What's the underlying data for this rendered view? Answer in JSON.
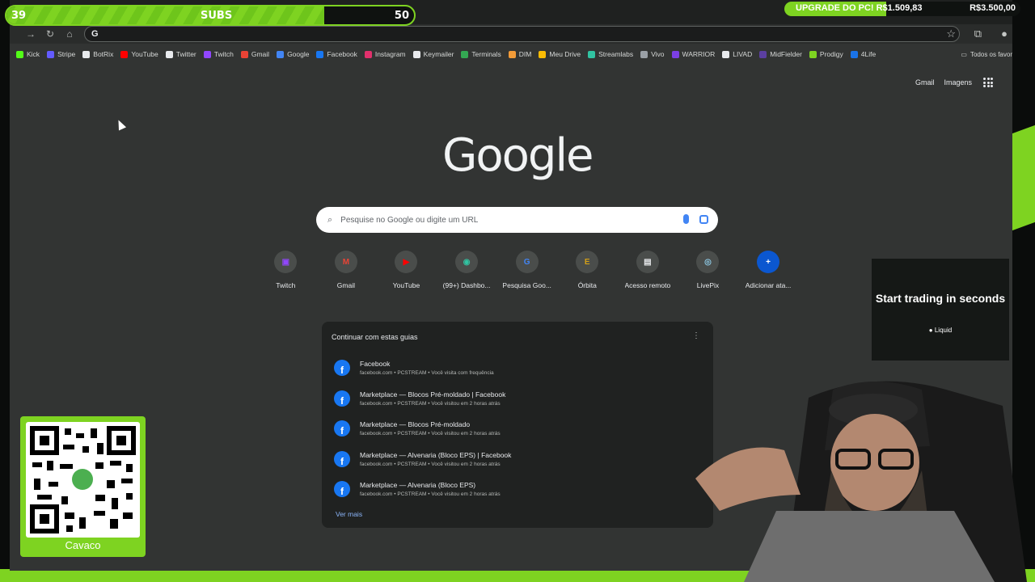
{
  "overlay": {
    "subs_current": "39",
    "subs_label": "SUBS",
    "subs_goal": "50",
    "subs_progress_fraction": 0.78,
    "upgrade_text": "UPGRADE DO PC! R$1.509,83",
    "upgrade_goal": "R$3.500,00",
    "upgrade_progress_fraction": 0.43,
    "qr_label": "Cavaco",
    "ad_title": "Start trading in seconds",
    "ad_brand": "Liquid"
  },
  "browser": {
    "omnibox_value": "G",
    "bookmarks": [
      {
        "label": "Kick",
        "color": "#53fc18"
      },
      {
        "label": "Stripe",
        "color": "#635bff"
      },
      {
        "label": "BotRix",
        "color": "#e8eaed"
      },
      {
        "label": "YouTube",
        "color": "#ff0000"
      },
      {
        "label": "Twitter",
        "color": "#e8eaed"
      },
      {
        "label": "Twitch",
        "color": "#9146ff"
      },
      {
        "label": "Gmail",
        "color": "#ea4335"
      },
      {
        "label": "Google",
        "color": "#4285f4"
      },
      {
        "label": "Facebook",
        "color": "#1877f2"
      },
      {
        "label": "Instagram",
        "color": "#e1306c"
      },
      {
        "label": "Keymailer",
        "color": "#e8eaed"
      },
      {
        "label": "Terminals",
        "color": "#34a853"
      },
      {
        "label": "DIM",
        "color": "#f29b38"
      },
      {
        "label": "Meu Drive",
        "color": "#fbbc04"
      },
      {
        "label": "Streamlabs",
        "color": "#31c3a2"
      },
      {
        "label": "Vivo",
        "color": "#9aa0a6"
      },
      {
        "label": "WARRIOR",
        "color": "#7b3fe4"
      },
      {
        "label": "LIVAD",
        "color": "#e8eaed"
      },
      {
        "label": "MidFielder",
        "color": "#5b3fa0"
      },
      {
        "label": "Prodigy",
        "color": "#7ed321"
      },
      {
        "label": "4Life",
        "color": "#1a73e8"
      }
    ],
    "bookmarks_all": "Todos os favor"
  },
  "google": {
    "top_links": [
      "Gmail",
      "Imagens"
    ],
    "logo": "Google",
    "search_placeholder": "Pesquise no Google ou digite um URL",
    "shortcuts": [
      {
        "label": "Twitch",
        "glyph": "▣",
        "color": "#9146ff"
      },
      {
        "label": "Gmail",
        "glyph": "M",
        "color": "#ea4335"
      },
      {
        "label": "YouTube",
        "glyph": "▶",
        "color": "#ff0000"
      },
      {
        "label": "(99+) Dashbo...",
        "glyph": "◉",
        "color": "#31c3a2"
      },
      {
        "label": "Pesquisa Goo...",
        "glyph": "G",
        "color": "#4285f4"
      },
      {
        "label": "Órbita",
        "glyph": "E",
        "color": "#d4a017"
      },
      {
        "label": "Acesso remoto",
        "glyph": "▤",
        "color": "#e8eaed"
      },
      {
        "label": "LivePix",
        "glyph": "◎",
        "color": "#8ecae6"
      },
      {
        "label": "Adicionar ata...",
        "glyph": "+",
        "color": "#8ab4f8"
      }
    ],
    "continue_title": "Continuar com estas guias",
    "tabs": [
      {
        "title": "Facebook",
        "subtitle": "facebook.com • PCSTREAM • Você visita com frequência"
      },
      {
        "title": "Marketplace — Blocos Pré-moldado | Facebook",
        "subtitle": "facebook.com • PCSTREAM • Você visitou em 2 horas atrás"
      },
      {
        "title": "Marketplace — Blocos Pré-moldado",
        "subtitle": "facebook.com • PCSTREAM • Você visitou em 2 horas atrás"
      },
      {
        "title": "Marketplace — Alvenaria (Bloco EPS) | Facebook",
        "subtitle": "facebook.com • PCSTREAM • Você visitou em 2 horas atrás"
      },
      {
        "title": "Marketplace — Alvenaria (Bloco EPS)",
        "subtitle": "facebook.com • PCSTREAM • Você visitou em 2 horas atrás"
      }
    ],
    "ver_mais": "Ver mais"
  }
}
